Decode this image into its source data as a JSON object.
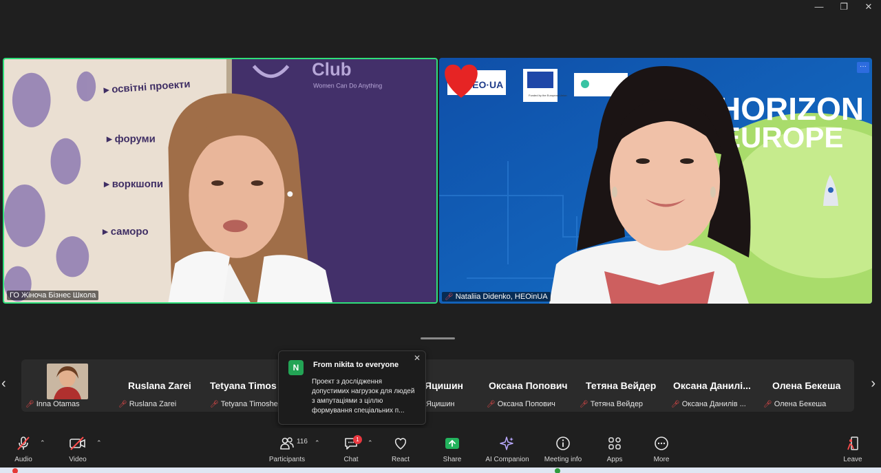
{
  "window": {
    "minimize": "—",
    "restore": "❐",
    "close": "✕"
  },
  "tiles": {
    "left": {
      "name": "ГО Жіноча Бізнес Школа",
      "banner_brand": "Club",
      "banner_tagline": "Women Can Do Anything",
      "banner_items": [
        "освітні проекти",
        "форуми",
        "воркшопи",
        "саморо"
      ]
    },
    "right": {
      "name": "Nataliia Didenko, HEOinUA",
      "logo_text": "HEO·UA",
      "eu_caption": "Funded by the European Union",
      "horizon_line1": "HORIZON",
      "horizon_line2": "EUROPE"
    }
  },
  "strip": {
    "prev": "‹",
    "next": "›",
    "participants": [
      {
        "label": "Inna Otamas",
        "big": ""
      },
      {
        "label": "Ruslana Zarei",
        "big": "Ruslana Zarei"
      },
      {
        "label": "Tetyana Timoshe...",
        "big": "Tetyana  Timos"
      },
      {
        "label": "Яцишин",
        "big": "Яцишин"
      },
      {
        "label": "Оксана Попович",
        "big": "Оксана Попович"
      },
      {
        "label": "Тетяна Вейдер",
        "big": "Тетяна Вейдер"
      },
      {
        "label": "Оксана Данилів ...",
        "big": "Оксана  Данилі..."
      },
      {
        "label": "Олена Бекеша",
        "big": "Олена Бекеша"
      }
    ]
  },
  "chat_popup": {
    "avatar": "N",
    "from": "From nikita to everyone",
    "close": "✕",
    "message": "Проект з дослідження допустимих нагрузок для людей з ампутаціями з ціллю формування спеціальних п..."
  },
  "toolbar": {
    "audio": "Audio",
    "video": "Video",
    "participants": "Participants",
    "participants_count": "116",
    "chat": "Chat",
    "chat_badge": "1",
    "react": "React",
    "share": "Share",
    "ai_companion": "AI Companion",
    "meeting_info": "Meeting info",
    "apps": "Apps",
    "more": "More",
    "leave": "Leave"
  },
  "colors": {
    "active_speaker": "#2ee07a",
    "share_green": "#23b35d",
    "mute_red": "#ff4d4d",
    "badge_red": "#e8373f"
  }
}
